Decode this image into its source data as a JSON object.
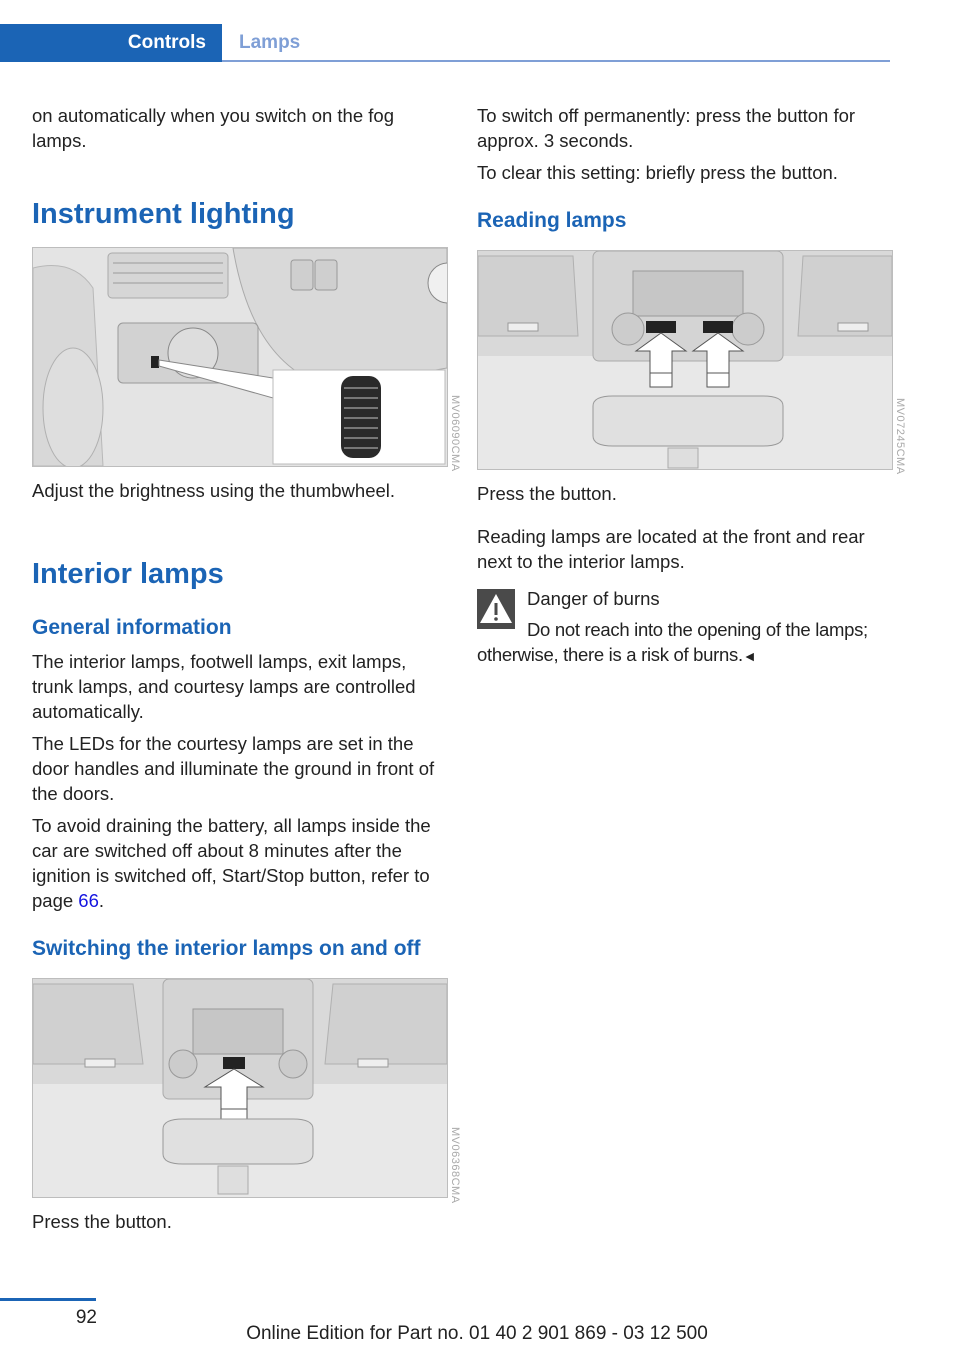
{
  "header": {
    "section": "Controls",
    "subsection": "Lamps"
  },
  "left_column": {
    "intro_text": "on automatically when you switch on the fog lamps.",
    "instrument_lighting": {
      "heading": "Instrument lighting",
      "figure_code": "MV06090CMA",
      "caption": "Adjust the brightness using the thumbwheel."
    },
    "interior_lamps": {
      "heading": "Interior lamps",
      "general_information": {
        "heading": "General information",
        "paragraph1": "The interior lamps, footwell lamps, exit lamps, trunk lamps, and courtesy lamps are controlled automatically.",
        "paragraph2": "The LEDs for the courtesy lamps are set in the door handles and illuminate the ground in front of the doors.",
        "paragraph3_text": "To avoid draining the battery, all lamps inside the car are switched off about 8 minutes after the ignition is switched off, Start/Stop button, refer to page ",
        "paragraph3_link": "66",
        "paragraph3_end": "."
      },
      "switching": {
        "heading": "Switching the interior lamps on and off",
        "figure_code": "MV06368CMA",
        "caption": "Press the button."
      }
    }
  },
  "right_column": {
    "switch_off_text": "To switch off permanently: press the button for approx. 3 seconds.",
    "clear_text": "To clear this setting: briefly press the button.",
    "reading_lamps": {
      "heading": "Reading lamps",
      "figure_code": "MV07245CMA",
      "caption": "Press the button.",
      "location_text": "Reading lamps are located at the front and rear next to the interior lamps."
    },
    "warning": {
      "icon": "warning-triangle-icon",
      "title": "Danger of burns",
      "body": "Do not reach into the opening of the lamps; otherwise, there is a risk of burns.",
      "end_mark": "◄"
    }
  },
  "footer": {
    "page_number": "92",
    "edition": "Online Edition for Part no. 01 40 2 901 869 - 03 12 500"
  },
  "colors": {
    "brand_blue": "#1b64b5",
    "header_light_blue": "#7f9fd6",
    "link_blue": "#1414e0",
    "text": "#222222"
  }
}
